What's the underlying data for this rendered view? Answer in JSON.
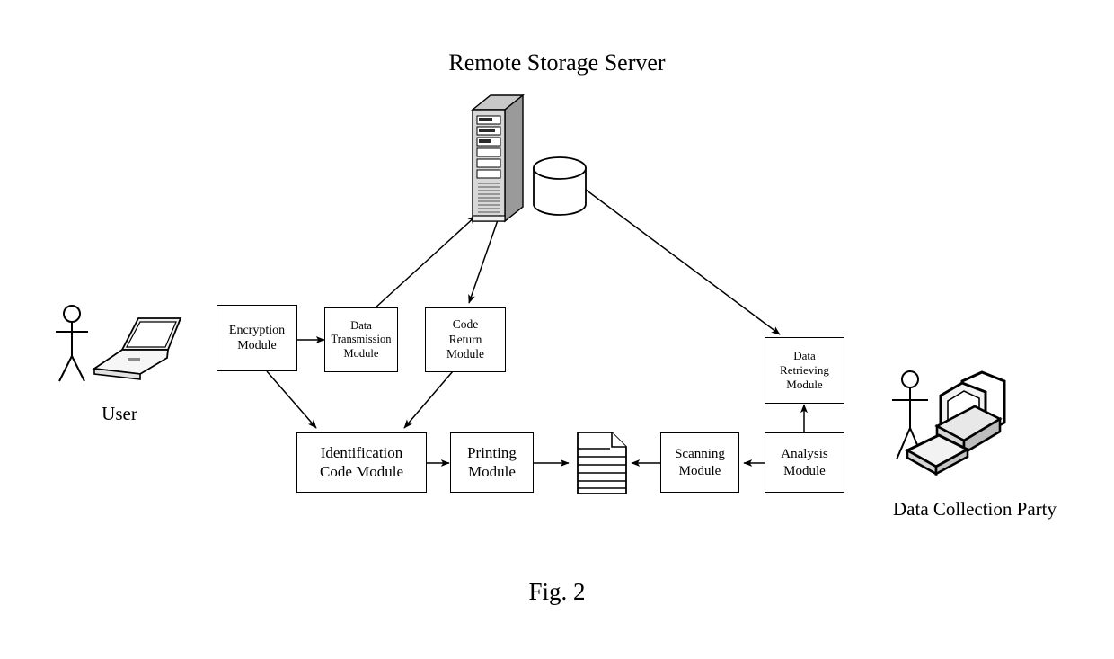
{
  "figure": {
    "title": "Remote Storage Server",
    "caption": "Fig. 2"
  },
  "actors": [
    {
      "id": "user",
      "label": "User",
      "icon": "person-with-laptop-icon"
    },
    {
      "id": "data-collection-party",
      "label": "Data Collection Party",
      "icon": "person-with-desktop-computer-icon"
    }
  ],
  "artifacts": [
    {
      "id": "remote-storage-server",
      "icon": "server-tower-icon",
      "label": "Remote Storage Server"
    },
    {
      "id": "storage-database",
      "icon": "database-cylinder-icon",
      "label": ""
    },
    {
      "id": "printed-document",
      "icon": "document-page-icon",
      "label": ""
    }
  ],
  "nodes": [
    {
      "id": "encryption-module",
      "lines": [
        "Encryption",
        "Module"
      ]
    },
    {
      "id": "data-transmission-module",
      "lines": [
        "Data",
        "Transmission",
        "Module"
      ]
    },
    {
      "id": "code-return-module",
      "lines": [
        "Code",
        "Return",
        "Module"
      ]
    },
    {
      "id": "data-retrieving-module",
      "lines": [
        "Data",
        "Retrieving",
        "Module"
      ]
    },
    {
      "id": "identification-code-module",
      "lines": [
        "Identification",
        "Code Module"
      ]
    },
    {
      "id": "printing-module",
      "lines": [
        "Printing",
        "Module"
      ]
    },
    {
      "id": "scanning-module",
      "lines": [
        "Scanning",
        "Module"
      ]
    },
    {
      "id": "analysis-module",
      "lines": [
        "Analysis",
        "Module"
      ]
    }
  ],
  "edges": [
    {
      "from": "encryption-module",
      "to": "data-transmission-module"
    },
    {
      "from": "data-transmission-module",
      "to": "remote-storage-server"
    },
    {
      "from": "remote-storage-server",
      "to": "code-return-module"
    },
    {
      "from": "encryption-module",
      "to": "identification-code-module"
    },
    {
      "from": "code-return-module",
      "to": "identification-code-module"
    },
    {
      "from": "identification-code-module",
      "to": "printing-module"
    },
    {
      "from": "printing-module",
      "to": "printed-document"
    },
    {
      "from": "printed-document",
      "to": "scanning-module",
      "direction": "left"
    },
    {
      "from": "scanning-module",
      "to": "analysis-module",
      "direction": "left"
    },
    {
      "from": "analysis-module",
      "to": "data-retrieving-module"
    },
    {
      "from": "storage-database",
      "to": "data-retrieving-module"
    }
  ],
  "style": {
    "line_color": "#000000",
    "background": "#ffffff"
  }
}
